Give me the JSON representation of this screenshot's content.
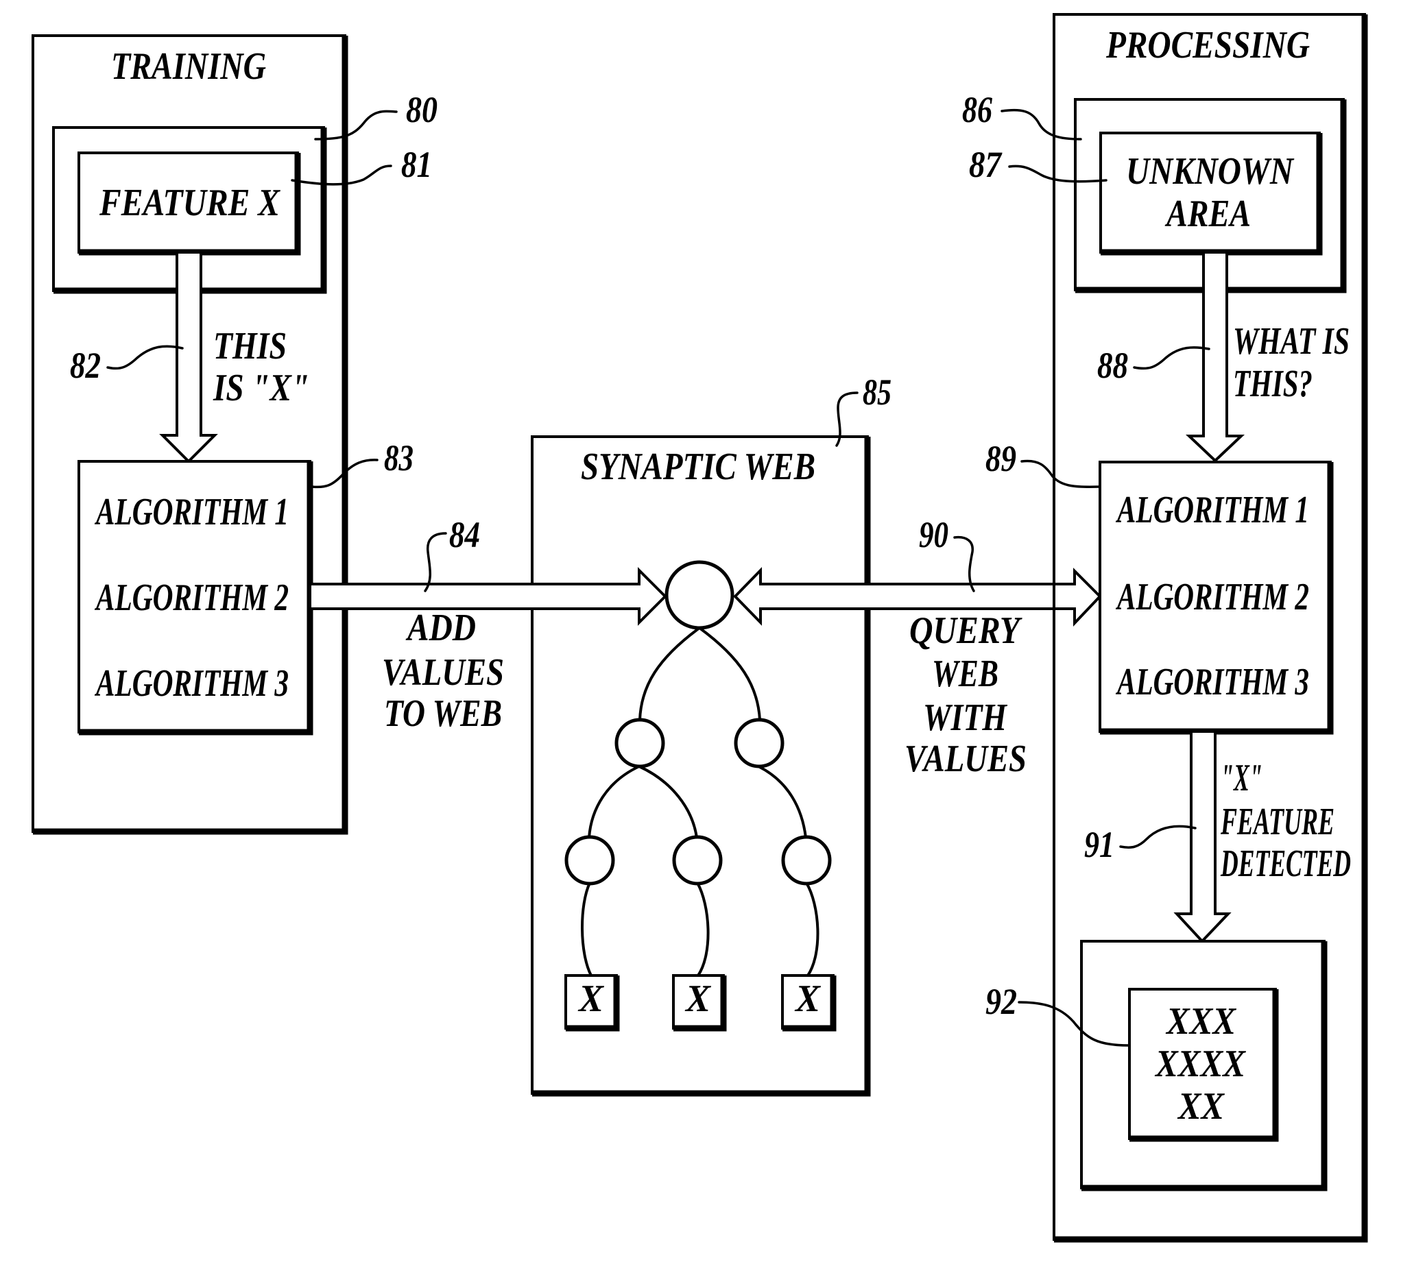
{
  "figure": {
    "training": {
      "title": "TRAINING",
      "feature_box": {
        "text": "FEATURE X",
        "ref_outer": "80",
        "ref_inner": "81"
      },
      "arrow": {
        "ref": "82",
        "label_lines": [
          "THIS",
          "IS \"X\""
        ]
      },
      "algorithms": {
        "ref": "83",
        "items": [
          "ALGORITHM 1",
          "ALGORITHM 2",
          "ALGORITHM 3"
        ]
      }
    },
    "add_arrow": {
      "ref": "84",
      "label_lines": [
        "ADD",
        "VALUES",
        "TO WEB"
      ]
    },
    "synaptic_web": {
      "ref": "85",
      "title": "SYNAPTIC WEB",
      "leaves": [
        "X",
        "X",
        "X"
      ]
    },
    "query_arrow": {
      "ref": "90",
      "label_lines": [
        "QUERY",
        "WEB",
        "WITH",
        "VALUES"
      ]
    },
    "processing": {
      "title": "PROCESSING",
      "unknown_box": {
        "lines": [
          "UNKNOWN",
          "AREA"
        ],
        "ref_outer": "86",
        "ref_inner": "87"
      },
      "arrow": {
        "ref": "88",
        "label_lines": [
          "WHAT IS",
          "THIS?"
        ]
      },
      "algorithms": {
        "ref": "89",
        "items": [
          "ALGORITHM 1",
          "ALGORITHM 2",
          "ALGORITHM 3"
        ]
      },
      "detect_arrow": {
        "ref": "91",
        "label_lines": [
          "\"X\"",
          "FEATURE",
          "DETECTED"
        ]
      },
      "result_box": {
        "ref": "92",
        "lines": [
          "XXX",
          "XXXX",
          "XX"
        ]
      }
    }
  }
}
